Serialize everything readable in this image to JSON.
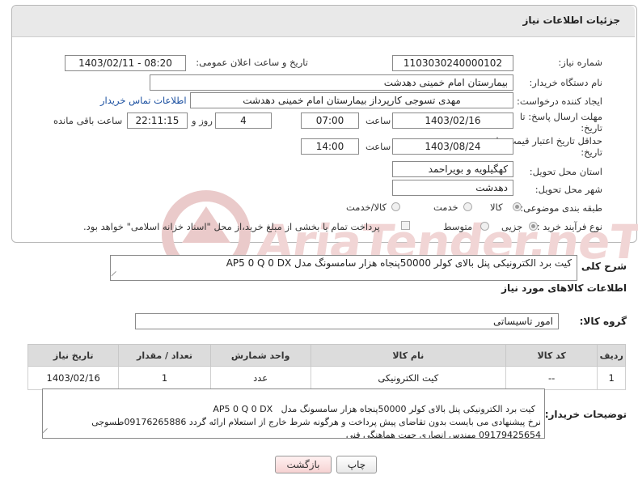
{
  "header": {
    "title": "جزئیات اطلاعات نیاز"
  },
  "fields": {
    "need_number_label": "شماره نیاز:",
    "need_number": "1103030240000102",
    "announce_label": "تاریخ و ساعت اعلان عمومی:",
    "announce_value": "1403/02/11 - 08:20",
    "buyer_org_label": "نام دستگاه خریدار:",
    "buyer_org": "بیمارستان امام خمینی دهدشت",
    "requester_label": "ایجاد کننده درخواست:",
    "requester": "مهدی تسوجی کارپرداز بیمارستان امام خمینی دهدشت",
    "buyer_contact_link": "اطلاعات تماس خریدار",
    "deadline_label": "مهلت ارسال پاسخ: تا تاریخ:",
    "deadline_date": "1403/02/16",
    "time_label": "ساعت",
    "deadline_time": "07:00",
    "days_value": "4",
    "days_label": "روز و",
    "remaining_time": "22:11:15",
    "remaining_label": "ساعت باقی مانده",
    "validity_label": "حداقل تاریخ اعتبار قیمت: تا تاریخ:",
    "validity_date": "1403/08/24",
    "validity_time": "14:00",
    "province_label": "استان محل تحویل:",
    "province": "کهگیلویه و بویراحمد",
    "city_label": "شهر محل تحویل:",
    "city": "دهدشت",
    "category_label": "طبقه بندی موضوعی:",
    "category_options": [
      "کالا",
      "خدمت",
      "کالا/خدمت"
    ],
    "process_label": "نوع فرآیند خرید :",
    "process_options": [
      "جزیی",
      "متوسط"
    ],
    "payment_note": "پرداخت تمام یا بخشی از مبلغ خرید،از محل \"اسناد خزانه اسلامی\" خواهد بود.",
    "description_label": "شرح کلی نیاز:",
    "description": "کیت برد الکترونیکی پنل بالای کولر 50000پنجاه هزار سامسونگ مدل   AP5 0 Q 0 DX"
  },
  "goods": {
    "section_title": "اطلاعات کالاهای مورد نیاز",
    "group_label": "گروه کالا:",
    "group_value": "امور تاسیساتی",
    "columns": [
      "ردیف",
      "کد کالا",
      "نام کالا",
      "واحد شمارش",
      "تعداد / مقدار",
      "تاریخ نیاز"
    ],
    "rows": [
      [
        "1",
        "--",
        "کیت الکترونیکی",
        "عدد",
        "1",
        "1403/02/16"
      ]
    ]
  },
  "buyer_notes": {
    "label": "توضیحات خریدار:",
    "text": "کیت برد الکترونیکی پنل بالای کولر 50000پنجاه هزار سامسونگ مدل   AP5 0 Q 0 DX\nنرخ پیشنهادی می بایست بدون تقاضای پیش پرداخت و هرگونه شرط خارج از استعلام ارائه گردد 09176265886طسوجی 09179425654 مهندس انصاری جهت هماهنگی فنی"
  },
  "buttons": {
    "print": "چاپ",
    "back": "بازگشت"
  },
  "watermark": {
    "text": "AriaTender.neT"
  },
  "colors": {
    "accent": "#8b1a1a",
    "link": "#1a4fa0",
    "watermark": "#e7b6b6"
  }
}
